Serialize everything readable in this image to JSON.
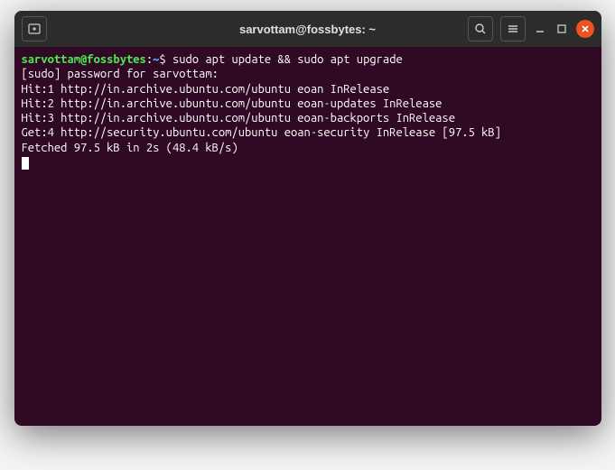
{
  "titlebar": {
    "title": "sarvottam@fossbytes: ~"
  },
  "prompt": {
    "user_host": "sarvottam@fossbytes",
    "separator": ":",
    "path": "~",
    "symbol": "$",
    "command": "sudo apt update && sudo apt upgrade"
  },
  "output": {
    "lines": [
      "[sudo] password for sarvottam:",
      "Hit:1 http://in.archive.ubuntu.com/ubuntu eoan InRelease",
      "Hit:2 http://in.archive.ubuntu.com/ubuntu eoan-updates InRelease",
      "Hit:3 http://in.archive.ubuntu.com/ubuntu eoan-backports InRelease",
      "Get:4 http://security.ubuntu.com/ubuntu eoan-security InRelease [97.5 kB]",
      "Fetched 97.5 kB in 2s (48.4 kB/s)"
    ]
  },
  "icons": {
    "new_tab": "new-tab-icon",
    "search": "search-icon",
    "menu": "hamburger-menu-icon",
    "minimize": "minimize-icon",
    "maximize": "maximize-icon",
    "close": "close-icon"
  }
}
